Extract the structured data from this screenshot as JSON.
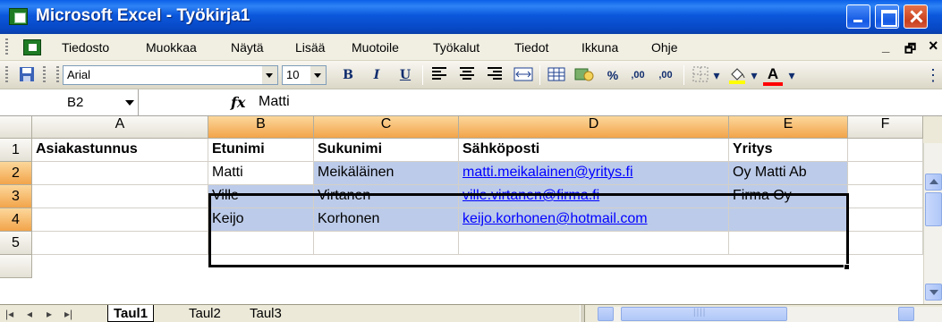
{
  "window": {
    "title": "Microsoft Excel - Työkirja1"
  },
  "menubar": {
    "items": [
      "Tiedosto",
      "Muokkaa",
      "Näytä",
      "Lisää",
      "Muotoile",
      "Työkalut",
      "Tiedot",
      "Ikkuna",
      "Ohje"
    ],
    "minimize_doc": "_",
    "restore_doc": "🗗",
    "close_doc": "×"
  },
  "toolbar": {
    "font_name": "Arial",
    "font_size": "10",
    "bold": "B",
    "italic": "I",
    "underline": "U",
    "percent": "%",
    "inc_decimal": "‚00",
    "dec_decimal": ",00",
    "font_color_glyph": "A"
  },
  "formulabar": {
    "name_box": "B2",
    "fx": "fx",
    "value": "Matti"
  },
  "grid": {
    "columns": [
      "A",
      "B",
      "C",
      "D",
      "E",
      "F"
    ],
    "rows": [
      "1",
      "2",
      "3",
      "4",
      "5"
    ],
    "selected_range": "B2:E4",
    "cells": {
      "A1": "Asiakastunnus",
      "B1": "Etunimi",
      "C1": "Sukunimi",
      "D1": "Sähköposti",
      "E1": "Yritys",
      "B2": "Matti",
      "C2": "Meikäläinen",
      "D2": "matti.meikalainen@yritys.fi",
      "E2": "Oy Matti Ab",
      "B3": "Ville",
      "C3": "Virtanen",
      "D3": "ville.virtanen@firma.fi",
      "E3": "Firma Oy",
      "B4": "Keijo",
      "C4": "Korhonen",
      "D4": "keijo.korhonen@hotmail.com"
    }
  },
  "sheets": {
    "tabs": [
      "Taul1",
      "Taul2",
      "Taul3"
    ],
    "active": "Taul1"
  },
  "colors": {
    "selection_fill": "#bccbe9",
    "header_selected": "#f2a44a",
    "hyperlink": "#0000ff"
  }
}
